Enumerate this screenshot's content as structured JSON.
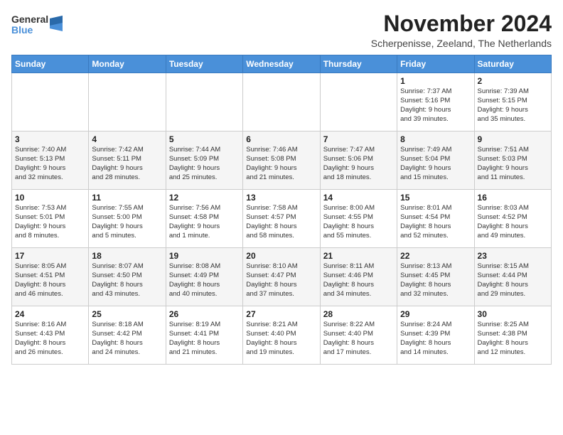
{
  "logo": {
    "general": "General",
    "blue": "Blue"
  },
  "header": {
    "month": "November 2024",
    "location": "Scherpenisse, Zeeland, The Netherlands"
  },
  "weekdays": [
    "Sunday",
    "Monday",
    "Tuesday",
    "Wednesday",
    "Thursday",
    "Friday",
    "Saturday"
  ],
  "weeks": [
    [
      {
        "day": "",
        "info": ""
      },
      {
        "day": "",
        "info": ""
      },
      {
        "day": "",
        "info": ""
      },
      {
        "day": "",
        "info": ""
      },
      {
        "day": "",
        "info": ""
      },
      {
        "day": "1",
        "info": "Sunrise: 7:37 AM\nSunset: 5:16 PM\nDaylight: 9 hours\nand 39 minutes."
      },
      {
        "day": "2",
        "info": "Sunrise: 7:39 AM\nSunset: 5:15 PM\nDaylight: 9 hours\nand 35 minutes."
      }
    ],
    [
      {
        "day": "3",
        "info": "Sunrise: 7:40 AM\nSunset: 5:13 PM\nDaylight: 9 hours\nand 32 minutes."
      },
      {
        "day": "4",
        "info": "Sunrise: 7:42 AM\nSunset: 5:11 PM\nDaylight: 9 hours\nand 28 minutes."
      },
      {
        "day": "5",
        "info": "Sunrise: 7:44 AM\nSunset: 5:09 PM\nDaylight: 9 hours\nand 25 minutes."
      },
      {
        "day": "6",
        "info": "Sunrise: 7:46 AM\nSunset: 5:08 PM\nDaylight: 9 hours\nand 21 minutes."
      },
      {
        "day": "7",
        "info": "Sunrise: 7:47 AM\nSunset: 5:06 PM\nDaylight: 9 hours\nand 18 minutes."
      },
      {
        "day": "8",
        "info": "Sunrise: 7:49 AM\nSunset: 5:04 PM\nDaylight: 9 hours\nand 15 minutes."
      },
      {
        "day": "9",
        "info": "Sunrise: 7:51 AM\nSunset: 5:03 PM\nDaylight: 9 hours\nand 11 minutes."
      }
    ],
    [
      {
        "day": "10",
        "info": "Sunrise: 7:53 AM\nSunset: 5:01 PM\nDaylight: 9 hours\nand 8 minutes."
      },
      {
        "day": "11",
        "info": "Sunrise: 7:55 AM\nSunset: 5:00 PM\nDaylight: 9 hours\nand 5 minutes."
      },
      {
        "day": "12",
        "info": "Sunrise: 7:56 AM\nSunset: 4:58 PM\nDaylight: 9 hours\nand 1 minute."
      },
      {
        "day": "13",
        "info": "Sunrise: 7:58 AM\nSunset: 4:57 PM\nDaylight: 8 hours\nand 58 minutes."
      },
      {
        "day": "14",
        "info": "Sunrise: 8:00 AM\nSunset: 4:55 PM\nDaylight: 8 hours\nand 55 minutes."
      },
      {
        "day": "15",
        "info": "Sunrise: 8:01 AM\nSunset: 4:54 PM\nDaylight: 8 hours\nand 52 minutes."
      },
      {
        "day": "16",
        "info": "Sunrise: 8:03 AM\nSunset: 4:52 PM\nDaylight: 8 hours\nand 49 minutes."
      }
    ],
    [
      {
        "day": "17",
        "info": "Sunrise: 8:05 AM\nSunset: 4:51 PM\nDaylight: 8 hours\nand 46 minutes."
      },
      {
        "day": "18",
        "info": "Sunrise: 8:07 AM\nSunset: 4:50 PM\nDaylight: 8 hours\nand 43 minutes."
      },
      {
        "day": "19",
        "info": "Sunrise: 8:08 AM\nSunset: 4:49 PM\nDaylight: 8 hours\nand 40 minutes."
      },
      {
        "day": "20",
        "info": "Sunrise: 8:10 AM\nSunset: 4:47 PM\nDaylight: 8 hours\nand 37 minutes."
      },
      {
        "day": "21",
        "info": "Sunrise: 8:11 AM\nSunset: 4:46 PM\nDaylight: 8 hours\nand 34 minutes."
      },
      {
        "day": "22",
        "info": "Sunrise: 8:13 AM\nSunset: 4:45 PM\nDaylight: 8 hours\nand 32 minutes."
      },
      {
        "day": "23",
        "info": "Sunrise: 8:15 AM\nSunset: 4:44 PM\nDaylight: 8 hours\nand 29 minutes."
      }
    ],
    [
      {
        "day": "24",
        "info": "Sunrise: 8:16 AM\nSunset: 4:43 PM\nDaylight: 8 hours\nand 26 minutes."
      },
      {
        "day": "25",
        "info": "Sunrise: 8:18 AM\nSunset: 4:42 PM\nDaylight: 8 hours\nand 24 minutes."
      },
      {
        "day": "26",
        "info": "Sunrise: 8:19 AM\nSunset: 4:41 PM\nDaylight: 8 hours\nand 21 minutes."
      },
      {
        "day": "27",
        "info": "Sunrise: 8:21 AM\nSunset: 4:40 PM\nDaylight: 8 hours\nand 19 minutes."
      },
      {
        "day": "28",
        "info": "Sunrise: 8:22 AM\nSunset: 4:40 PM\nDaylight: 8 hours\nand 17 minutes."
      },
      {
        "day": "29",
        "info": "Sunrise: 8:24 AM\nSunset: 4:39 PM\nDaylight: 8 hours\nand 14 minutes."
      },
      {
        "day": "30",
        "info": "Sunrise: 8:25 AM\nSunset: 4:38 PM\nDaylight: 8 hours\nand 12 minutes."
      }
    ]
  ]
}
